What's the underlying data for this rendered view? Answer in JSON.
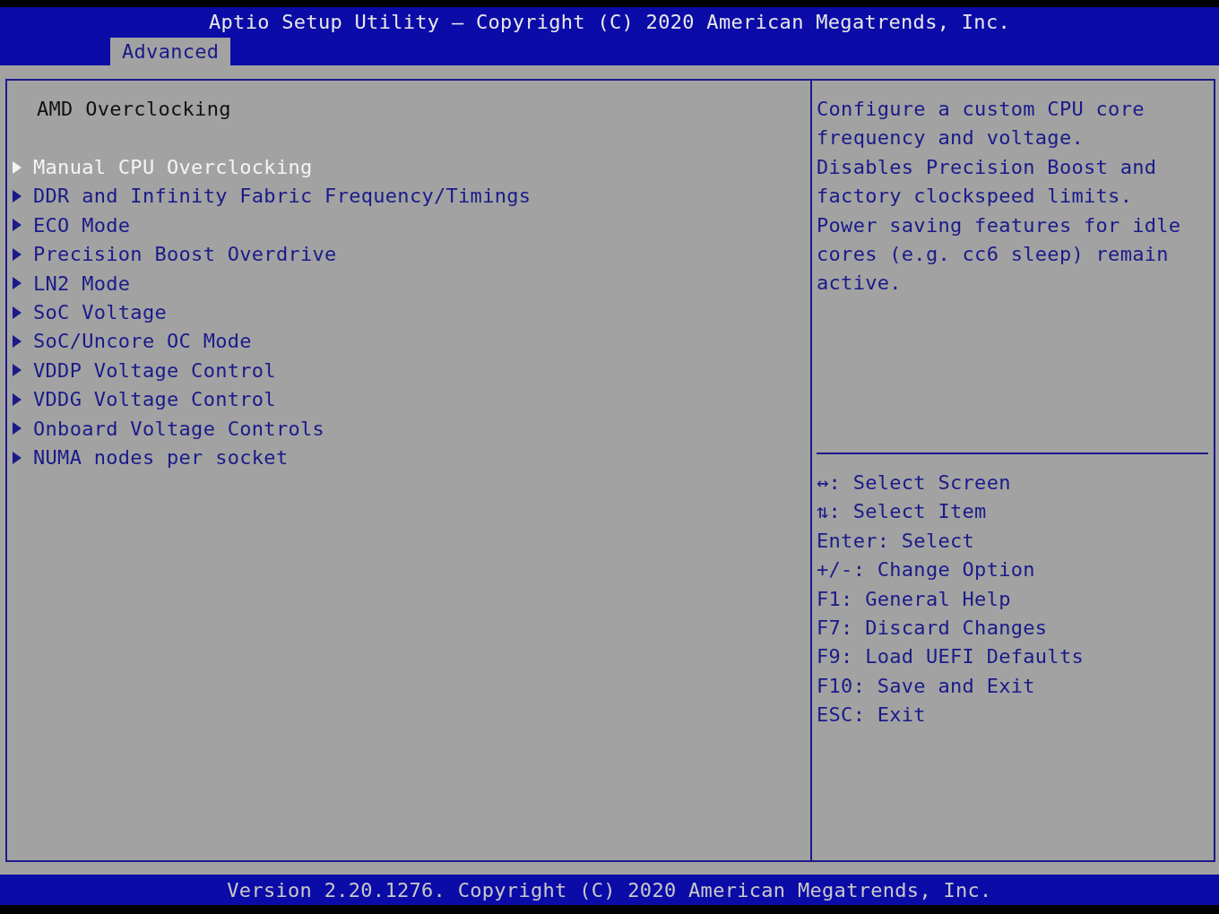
{
  "window": {
    "title": "Aptio Setup Utility – Copyright (C) 2020 American Megatrends, Inc."
  },
  "tabs": [
    {
      "label": "Advanced",
      "selected": true
    }
  ],
  "page": {
    "heading": "AMD Overclocking",
    "items": [
      {
        "label": "Manual CPU Overclocking",
        "selected": true
      },
      {
        "label": "DDR and Infinity Fabric Frequency/Timings",
        "selected": false
      },
      {
        "label": "ECO Mode",
        "selected": false
      },
      {
        "label": "Precision Boost Overdrive",
        "selected": false
      },
      {
        "label": "LN2 Mode",
        "selected": false
      },
      {
        "label": "SoC Voltage",
        "selected": false
      },
      {
        "label": "SoC/Uncore OC Mode",
        "selected": false
      },
      {
        "label": "VDDP Voltage Control",
        "selected": false
      },
      {
        "label": "VDDG Voltage Control",
        "selected": false
      },
      {
        "label": "Onboard Voltage Controls",
        "selected": false
      },
      {
        "label": "NUMA nodes per socket",
        "selected": false
      }
    ]
  },
  "help": {
    "paragraphs": [
      "Configure a custom CPU core frequency and voltage.",
      "Disables Precision Boost and factory clockspeed limits.",
      "Power saving features for idle cores (e.g. cc6 sleep) remain active."
    ]
  },
  "keys": [
    "↔: Select Screen",
    "⇅: Select Item",
    "Enter: Select",
    "+/-: Change Option",
    "F1: General Help",
    "F7: Discard Changes",
    "F9: Load UEFI Defaults",
    "F10: Save and Exit",
    "ESC: Exit"
  ],
  "status_bar": {
    "text": "Version 2.20.1276. Copyright (C) 2020 American Megatrends, Inc."
  }
}
